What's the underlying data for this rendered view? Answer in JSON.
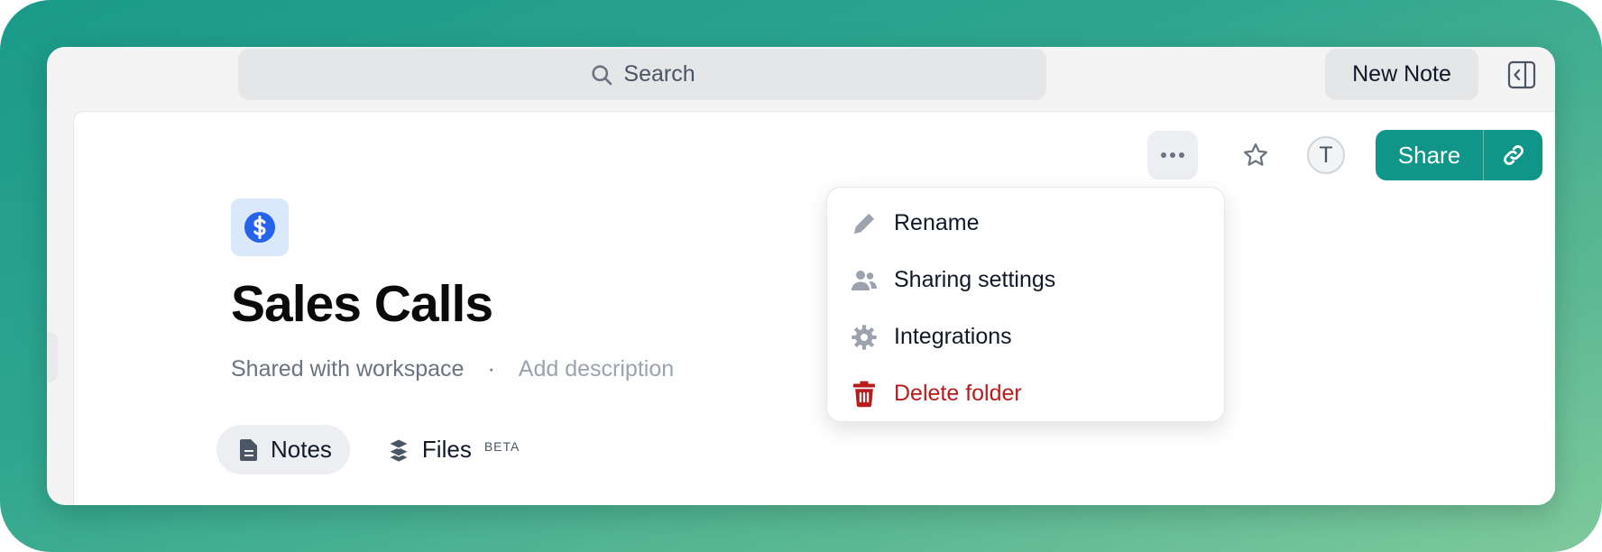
{
  "search": {
    "label": "Search"
  },
  "toolbar": {
    "new_note_label": "New Note"
  },
  "header": {
    "avatar_initial": "T",
    "share_label": "Share"
  },
  "folder": {
    "title": "Sales Calls",
    "shared_status": "Shared with workspace",
    "separator": "·",
    "description_placeholder": "Add description",
    "icon": "dollar-icon"
  },
  "tabs": [
    {
      "label": "Notes",
      "icon": "document-icon",
      "active": true
    },
    {
      "label": "Files",
      "icon": "layers-icon",
      "badge": "BETA",
      "active": false
    }
  ],
  "menu": {
    "items": [
      {
        "label": "Rename",
        "icon": "pencil-icon"
      },
      {
        "label": "Sharing settings",
        "icon": "users-icon"
      },
      {
        "label": "Integrations",
        "icon": "gear-icon"
      },
      {
        "label": "Delete folder",
        "icon": "trash-icon",
        "danger": true
      }
    ]
  },
  "colors": {
    "accent": "#0f9688",
    "danger": "#b91c1c",
    "folder_icon": "#2563eb",
    "folder_icon_bg": "#dbe7fb"
  }
}
